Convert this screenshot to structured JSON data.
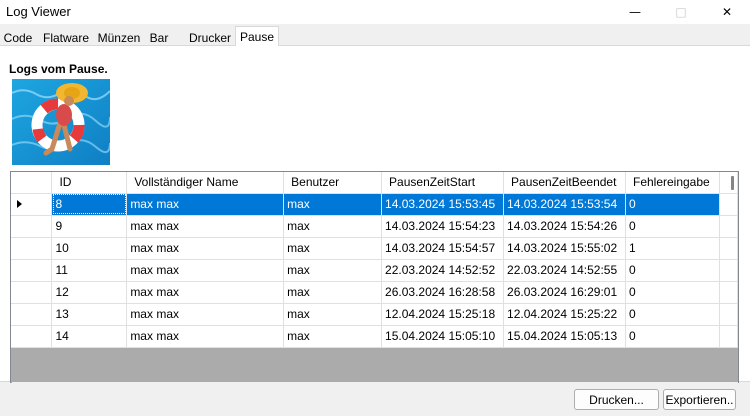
{
  "window": {
    "title": "Log Viewer"
  },
  "tabs": [
    "Code",
    "Flatware",
    "Münzen",
    "Bar",
    "Drucker",
    "Pause"
  ],
  "section_title": "Logs vom Pause.",
  "grid": {
    "columns": [
      "ID",
      "Vollständiger Name",
      "Benutzer",
      "PausenZeitStart",
      "PausenZeitBeendet",
      "Fehlereingabe"
    ],
    "rows": [
      [
        "8",
        "max max",
        "max",
        "14.03.2024 15:53:45",
        "14.03.2024 15:53:54",
        "0"
      ],
      [
        "9",
        "max max",
        "max",
        "14.03.2024 15:54:23",
        "14.03.2024 15:54:26",
        "0"
      ],
      [
        "10",
        "max max",
        "max",
        "14.03.2024 15:54:57",
        "14.03.2024 15:55:02",
        "1"
      ],
      [
        "11",
        "max max",
        "max",
        "22.03.2024 14:52:52",
        "22.03.2024 14:52:55",
        "0"
      ],
      [
        "12",
        "max max",
        "max",
        "26.03.2024 16:28:58",
        "26.03.2024 16:29:01",
        "0"
      ],
      [
        "13",
        "max max",
        "max",
        "12.04.2024 15:25:18",
        "12.04.2024 15:25:22",
        "0"
      ],
      [
        "14",
        "max max",
        "max",
        "15.04.2024 15:05:10",
        "15.04.2024 15:05:13",
        "0"
      ]
    ],
    "selected_row": 0
  },
  "buttons": {
    "print": "Drucken...",
    "export": "Exportieren.."
  },
  "colors": {
    "selection": "#0078d7",
    "grid_border": "#828790",
    "tab_border": "#d9d9d9"
  }
}
